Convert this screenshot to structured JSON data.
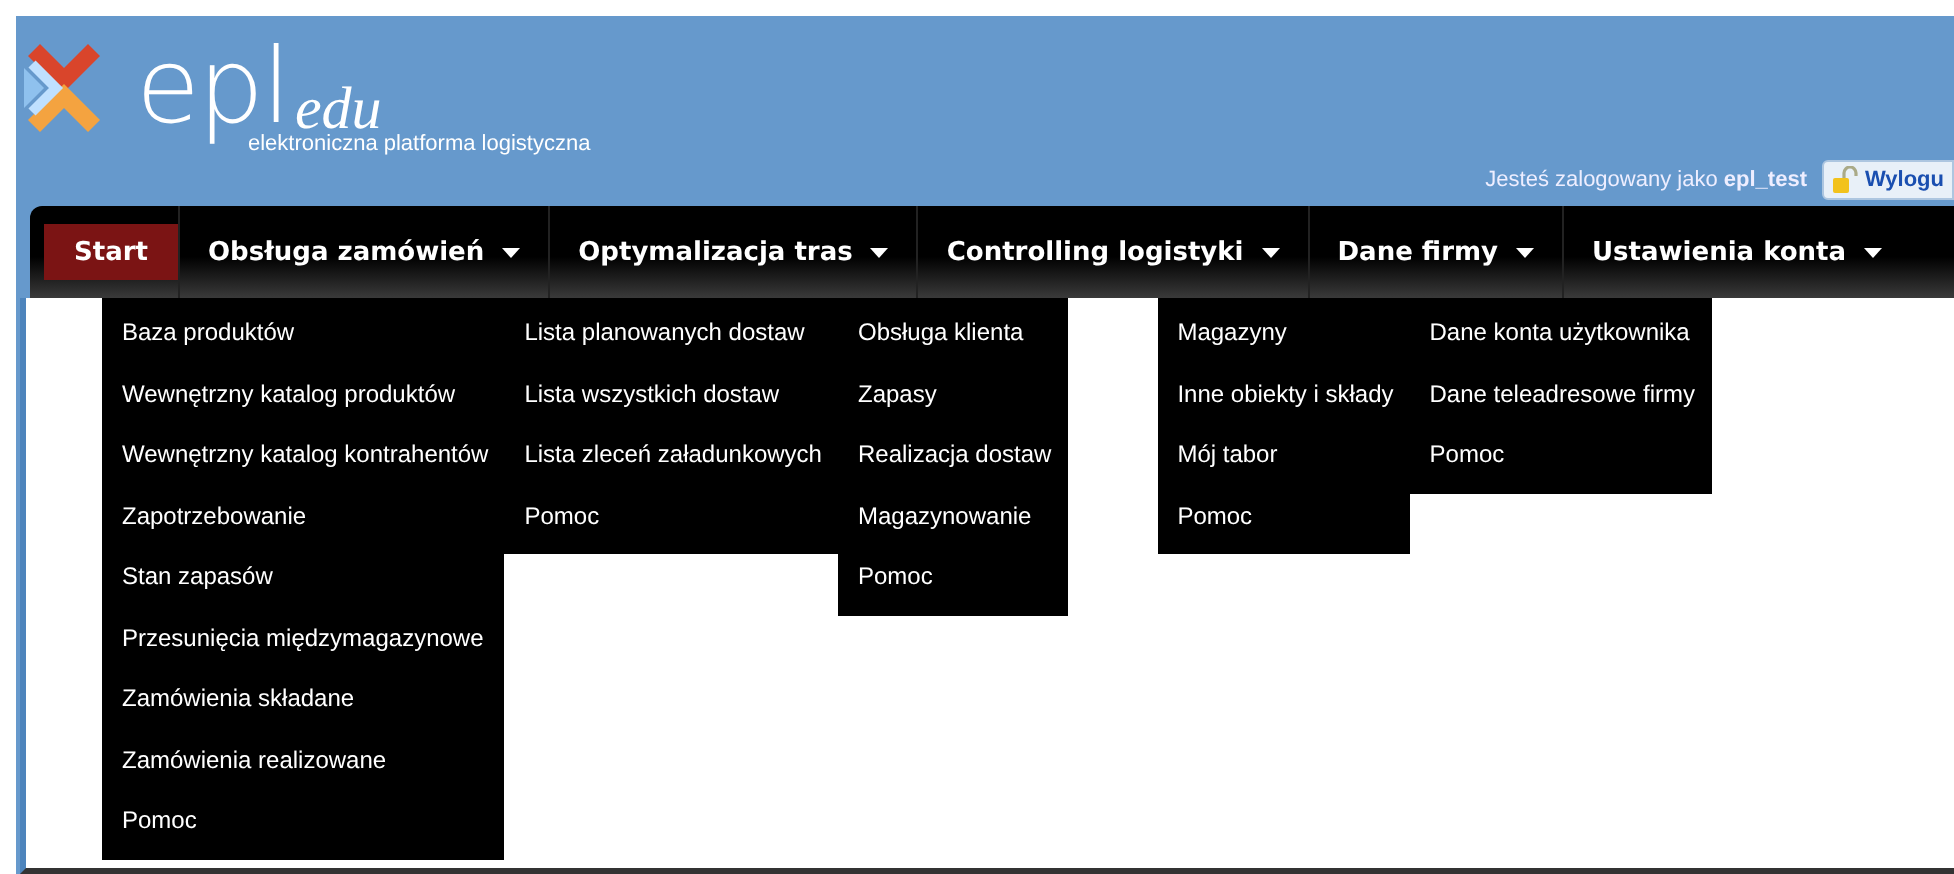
{
  "logo": {
    "word": "epl",
    "suffix": "edu",
    "tagline": "elektroniczna platforma logistyczna"
  },
  "user": {
    "prefix": "Jesteś zalogowany jako",
    "login": "epl_test",
    "logout": "Wylogu"
  },
  "nav": [
    {
      "label": "Start",
      "selected": true,
      "dropdown": false
    },
    {
      "label": "Obsługa zamówień",
      "selected": false,
      "dropdown": true
    },
    {
      "label": "Optymalizacja tras",
      "selected": false,
      "dropdown": true
    },
    {
      "label": "Controlling logistyki",
      "selected": false,
      "dropdown": true
    },
    {
      "label": "Dane firmy",
      "selected": false,
      "dropdown": true
    },
    {
      "label": "Ustawienia konta",
      "selected": false,
      "dropdown": true
    }
  ],
  "menus": [
    {
      "items": [
        "Baza produktów",
        "Wewnętrzny katalog produktów",
        "Wewnętrzny katalog kontrahentów",
        "Zapotrzebowanie",
        "Stan zapasów",
        "Przesunięcia międzymagazynowe",
        "Zamówienia składane",
        "Zamówienia realizowane",
        "Pomoc"
      ]
    },
    {
      "items": [
        "Lista planowanych dostaw",
        "Lista wszystkich dostaw",
        "Lista zleceń załadunkowych",
        "Pomoc"
      ]
    },
    {
      "items": [
        "Obsługa klienta",
        "Zapasy",
        "Realizacja dostaw",
        "Magazynowanie",
        "Pomoc"
      ]
    },
    {
      "items": [
        "Magazyny",
        "Inne obiekty i składy",
        "Mój tabor",
        "Pomoc"
      ]
    },
    {
      "items": [
        "Dane konta użytkownika",
        "Dane teleadresowe firmy",
        "Pomoc"
      ]
    }
  ]
}
